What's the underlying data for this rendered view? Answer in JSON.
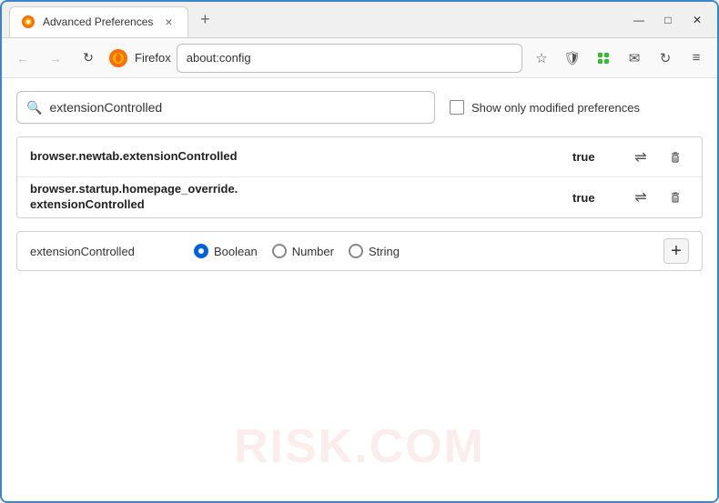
{
  "window": {
    "title": "Advanced Preferences",
    "new_tab_symbol": "+",
    "close_symbol": "✕",
    "minimize_symbol": "—",
    "maximize_symbol": "□"
  },
  "tab": {
    "label": "Advanced Preferences",
    "close": "×"
  },
  "nav": {
    "back": "←",
    "forward": "→",
    "reload": "↻",
    "firefox_label": "Firefox",
    "address": "about:config",
    "bookmark_icon": "☆",
    "shield_icon": "🛡",
    "extension_icon": "🧩",
    "mail_icon": "✉",
    "sync_icon": "↻",
    "menu_icon": "≡"
  },
  "search": {
    "placeholder": "extensionControlled",
    "value": "extensionControlled",
    "show_modified_label": "Show only modified preferences"
  },
  "results": [
    {
      "name": "browser.newtab.extensionControlled",
      "value": "true"
    },
    {
      "name": "browser.startup.homepage_override.\nextensionControlled",
      "name_line1": "browser.startup.homepage_override.",
      "name_line2": "extensionControlled",
      "value": "true",
      "multiline": true
    }
  ],
  "add_row": {
    "name": "extensionControlled",
    "types": [
      {
        "label": "Boolean",
        "selected": true
      },
      {
        "label": "Number",
        "selected": false
      },
      {
        "label": "String",
        "selected": false
      }
    ],
    "add_button": "+"
  },
  "watermark": "RISK.COM"
}
